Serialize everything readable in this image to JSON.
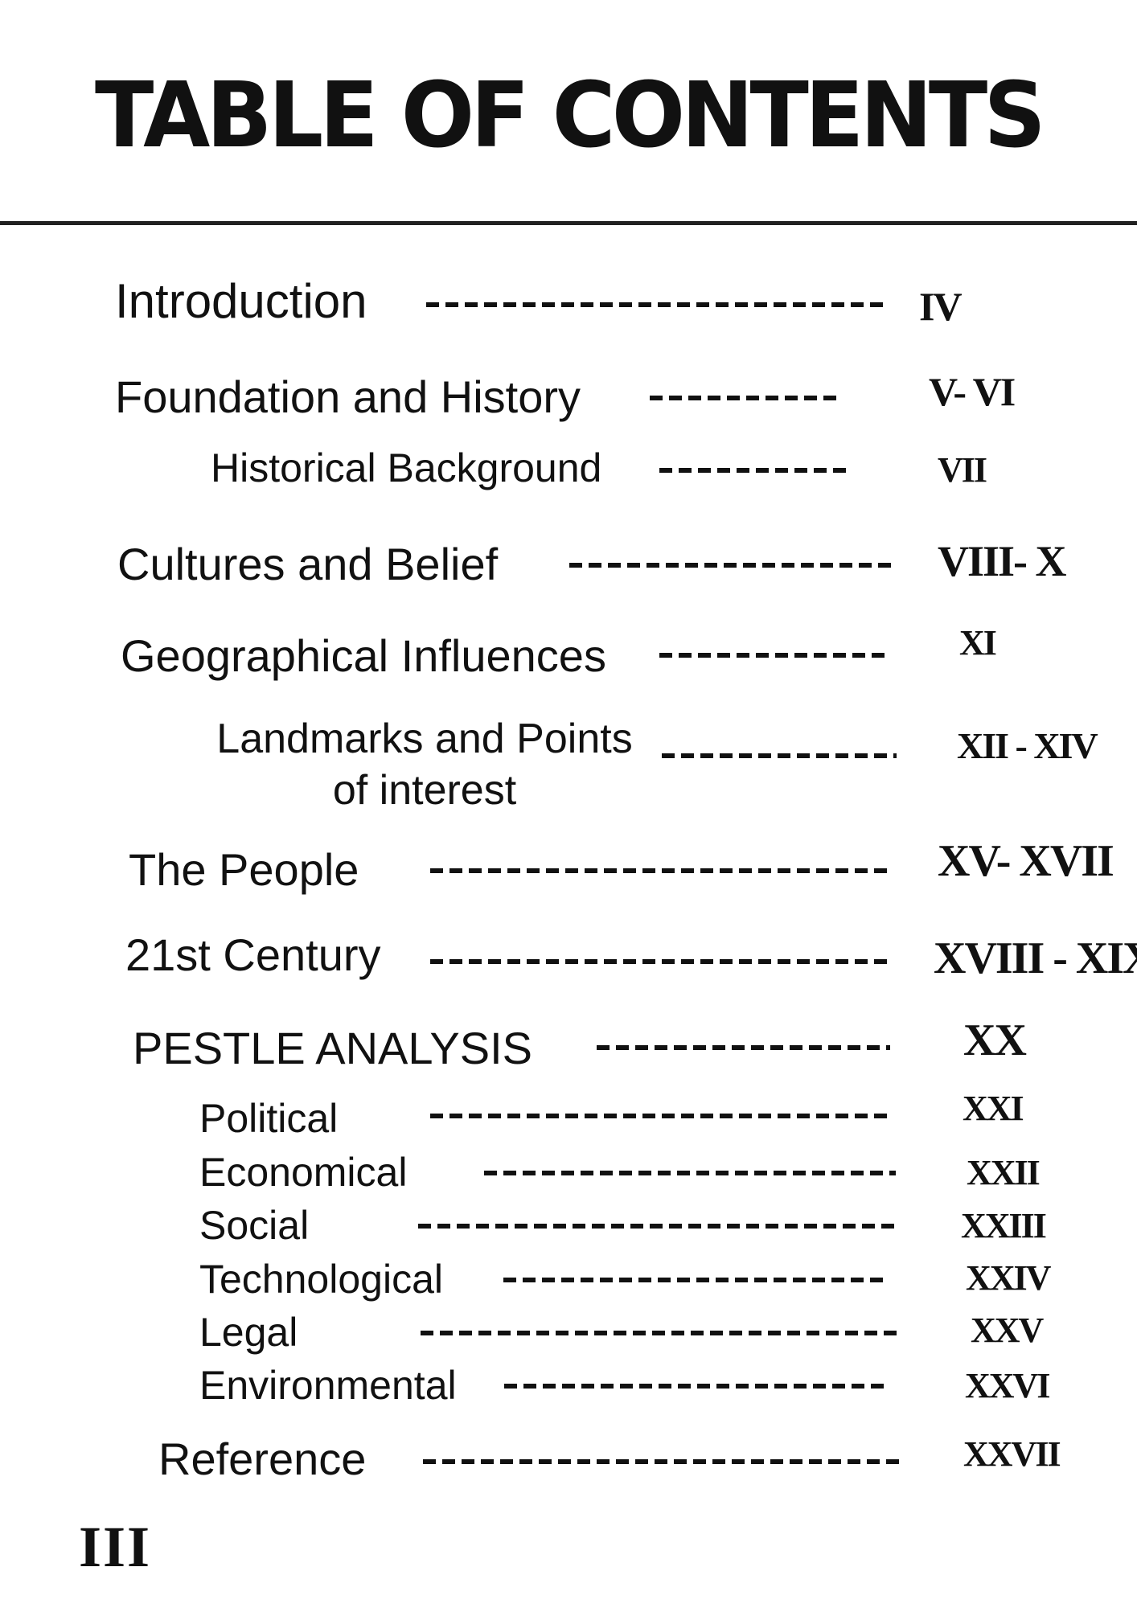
{
  "title": "TABLE OF CONTENTS",
  "entries": [
    {
      "label": "Introduction",
      "pages": "IV"
    },
    {
      "label": "Foundation and History",
      "pages": "V- VI"
    },
    {
      "label": "Historical Background",
      "pages": "VII"
    },
    {
      "label": "Cultures and Belief",
      "pages": "VIII- X"
    },
    {
      "label": "Geographical Influences",
      "pages": "XI"
    },
    {
      "label": "Landmarks and Points of interest",
      "pages": "XII - XIV"
    },
    {
      "label": "The People",
      "pages": "XV- XVII"
    },
    {
      "label": "21st Century",
      "pages": "XVIII - XIX"
    },
    {
      "label": "PESTLE ANALYSIS",
      "pages": "XX"
    },
    {
      "label": "Political",
      "pages": "XXI"
    },
    {
      "label": "Economical",
      "pages": "XXII"
    },
    {
      "label": "Social",
      "pages": "XXIII"
    },
    {
      "label": "Technological",
      "pages": "XXIV"
    },
    {
      "label": "Legal",
      "pages": "XXV"
    },
    {
      "label": "Environmental",
      "pages": "XXVI"
    },
    {
      "label": "Reference",
      "pages": "XXVII"
    }
  ],
  "page_number": "III"
}
